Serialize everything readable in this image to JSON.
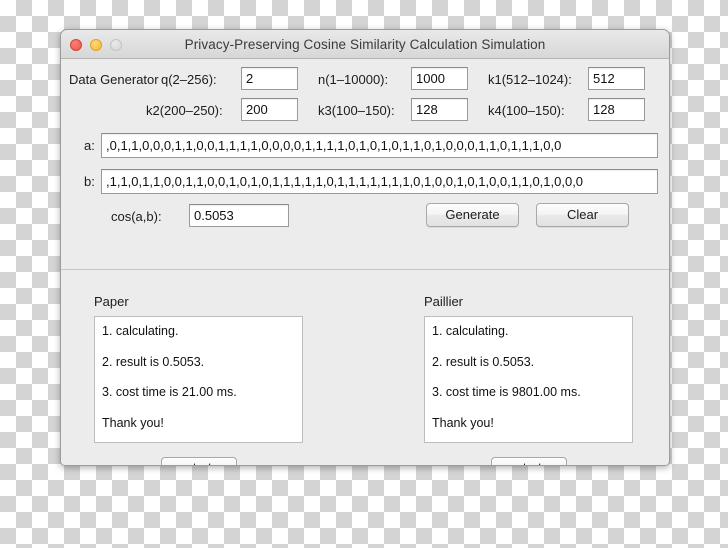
{
  "window": {
    "title": "Privacy-Preserving Cosine Similarity Calculation Simulation",
    "controls": {
      "close": "close-button",
      "minimize": "minimize-button",
      "zoom": "zoom-button"
    }
  },
  "generator": {
    "section_label": "Data Generator",
    "params": [
      {
        "label": "q(2–256):",
        "value": "2"
      },
      {
        "label": "n(1–10000):",
        "value": "1000"
      },
      {
        "label": "k1(512–1024):",
        "value": "512"
      },
      {
        "label": "k2(200–250):",
        "value": "200"
      },
      {
        "label": "k3(100–150):",
        "value": "128"
      },
      {
        "label": "k4(100–150):",
        "value": "128"
      }
    ]
  },
  "vectors": {
    "a_label": "a:",
    "a_value": ",0,1,1,0,0,0,1,1,0,0,1,1,1,1,0,0,0,0,1,1,1,1,0,1,0,1,0,1,1,0,1,0,0,0,1,1,0,1,1,1,0,0",
    "b_label": "b:",
    "b_value": ",1,1,0,1,1,0,0,1,1,0,0,1,0,1,0,1,1,1,1,1,0,1,1,1,1,1,1,1,0,1,0,0,1,0,1,0,0,1,1,0,1,0,0,0"
  },
  "cosine": {
    "label": "cos(a,b):",
    "value": "0.5053"
  },
  "actions": {
    "generate": "Generate",
    "clear": "Clear"
  },
  "results": {
    "left": {
      "title": "Paper",
      "lines": [
        "1. calculating.",
        "2. result is 0.5053.",
        "3. cost time is 21.00 ms.",
        "Thank you!"
      ],
      "start": "start"
    },
    "right": {
      "title": "Paillier",
      "lines": [
        "1. calculating.",
        "2. result is 0.5053.",
        "3. cost time is 9801.00 ms.",
        "Thank you!"
      ],
      "start": "start"
    }
  },
  "colors": {
    "close": "#e8554b",
    "minimize": "#f7b733",
    "zoom": "#d5d5d5",
    "window_bg": "#ececec",
    "field_bg": "#ffffff"
  }
}
